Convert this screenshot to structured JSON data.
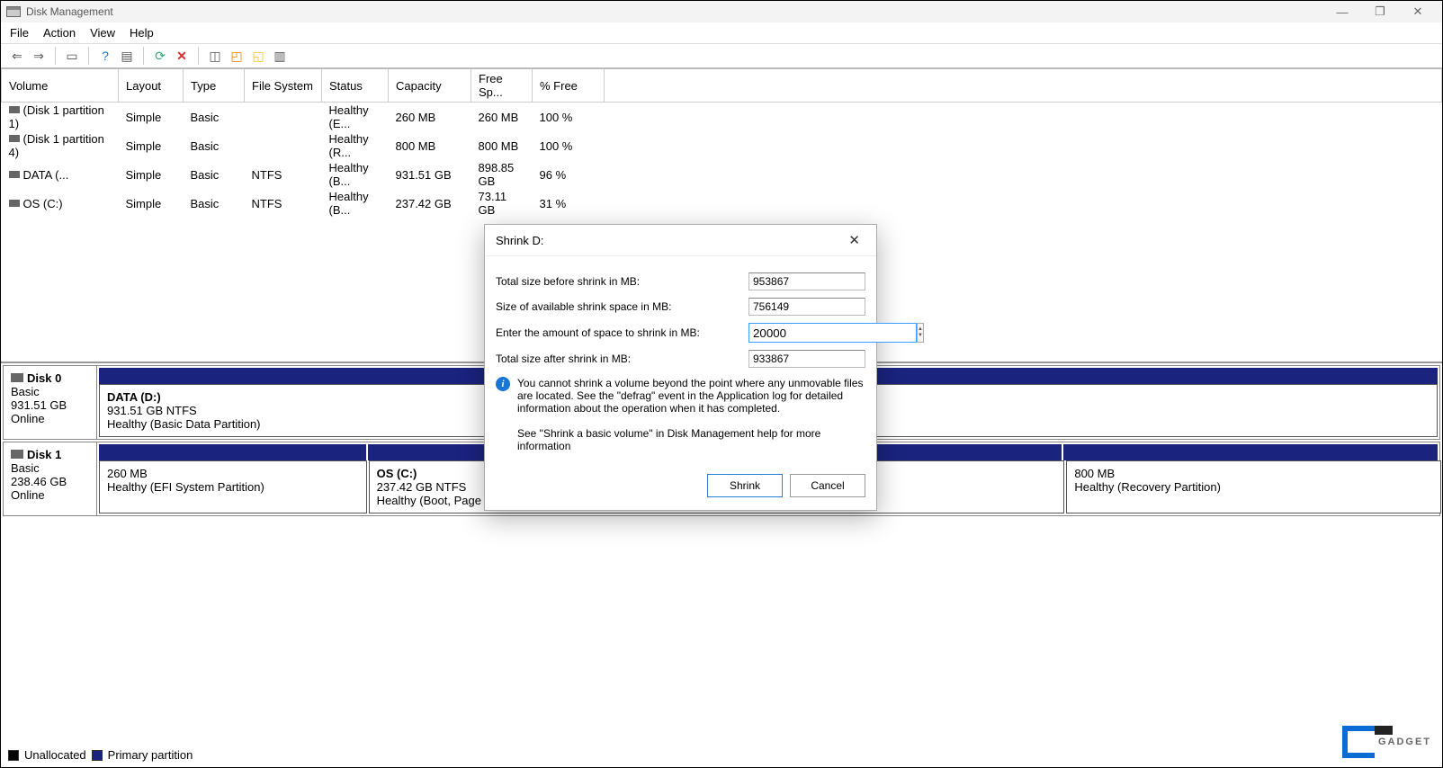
{
  "window": {
    "title": "Disk Management"
  },
  "win_controls": {
    "min": "—",
    "max": "❐",
    "close": "✕"
  },
  "menubar": [
    "File",
    "Action",
    "View",
    "Help"
  ],
  "toolbar_icons": {
    "back": "back-icon",
    "fwd": "forward-icon",
    "show": "show-pane-icon",
    "help": "help-icon",
    "props": "properties-icon",
    "refresh": "refresh-icon",
    "delete": "delete-icon",
    "t1": "tool-icon",
    "t2": "tool-icon",
    "t3": "tool-icon",
    "t4": "tool-icon"
  },
  "vol_headers": [
    "Volume",
    "Layout",
    "Type",
    "File System",
    "Status",
    "Capacity",
    "Free Sp...",
    "% Free"
  ],
  "volumes": [
    {
      "name": "(Disk 1 partition 1)",
      "layout": "Simple",
      "type": "Basic",
      "fs": "",
      "status": "Healthy (E...",
      "cap": "260 MB",
      "free": "260 MB",
      "pct": "100 %"
    },
    {
      "name": "(Disk 1 partition 4)",
      "layout": "Simple",
      "type": "Basic",
      "fs": "",
      "status": "Healthy (R...",
      "cap": "800 MB",
      "free": "800 MB",
      "pct": "100 %"
    },
    {
      "name": "DATA (...",
      "layout": "Simple",
      "type": "Basic",
      "fs": "NTFS",
      "status": "Healthy (B...",
      "cap": "931.51 GB",
      "free": "898.85 GB",
      "pct": "96 %"
    },
    {
      "name": "OS (C:)",
      "layout": "Simple",
      "type": "Basic",
      "fs": "NTFS",
      "status": "Healthy (B...",
      "cap": "237.42 GB",
      "free": "73.11 GB",
      "pct": "31 %"
    }
  ],
  "disks": [
    {
      "name": "Disk 0",
      "type": "Basic",
      "size": "931.51 GB",
      "state": "Online",
      "parts": [
        {
          "w": "100%",
          "title": "DATA  (D:)",
          "sub": "931.51 GB NTFS",
          "status": "Healthy (Basic Data Partition)"
        }
      ]
    },
    {
      "name": "Disk 1",
      "type": "Basic",
      "size": "238.46 GB",
      "state": "Online",
      "parts": [
        {
          "w": "20%",
          "title": "",
          "sub": "260 MB",
          "status": "Healthy (EFI System Partition)"
        },
        {
          "w": "52%",
          "title": "OS  (C:)",
          "sub": "237.42 GB NTFS",
          "status": "Healthy (Boot, Page File, Crash Dump, Basic Data Partition)"
        },
        {
          "w": "28%",
          "title": "",
          "sub": "800 MB",
          "status": "Healthy (Recovery Partition)"
        }
      ]
    }
  ],
  "legend": {
    "a": "Unallocated",
    "b": "Primary partition"
  },
  "dialog": {
    "title": "Shrink D:",
    "total_before_lbl": "Total size before shrink in MB:",
    "total_before_val": "953867",
    "avail_lbl": "Size of available shrink space in MB:",
    "avail_val": "756149",
    "enter_lbl": "Enter the amount of space to shrink in MB:",
    "enter_val": "20000",
    "total_after_lbl": "Total size after shrink in MB:",
    "total_after_val": "933867",
    "warn1": "You cannot shrink a volume beyond the point where any unmovable files are located. See the \"defrag\" event in the Application log for detailed information about the operation when it has completed.",
    "warn2": "See \"Shrink a basic volume\" in Disk Management help for more information",
    "shrink": "Shrink",
    "cancel": "Cancel"
  },
  "watermark": "GADGET"
}
